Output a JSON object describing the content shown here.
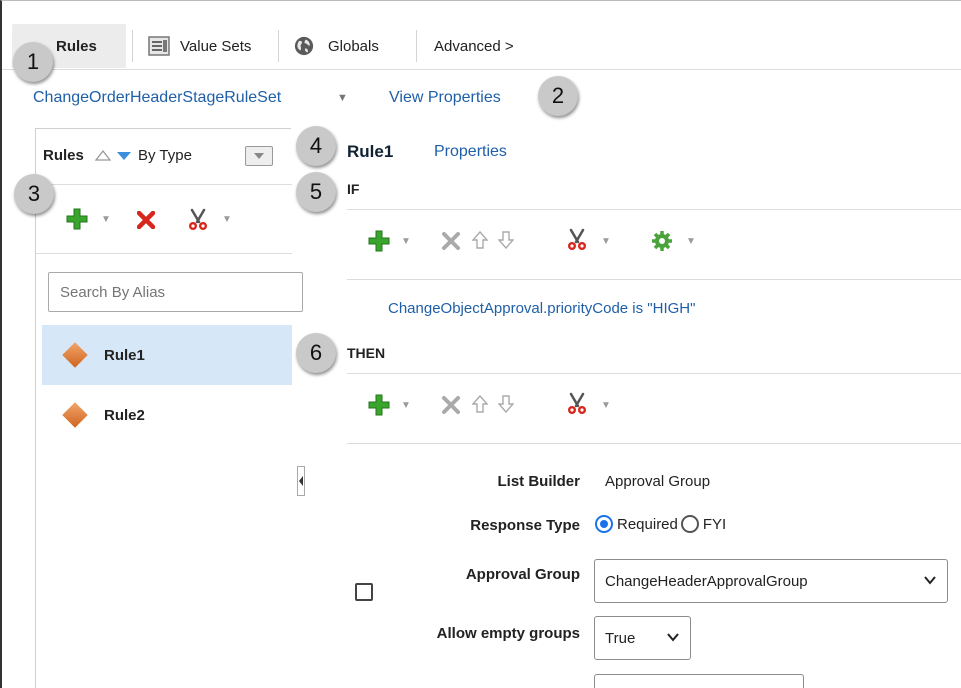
{
  "tabs": {
    "rules": "Rules",
    "value_sets": "Value Sets",
    "globals": "Globals",
    "advanced": "Advanced >"
  },
  "ruleset": {
    "name": "ChangeOrderHeaderStageRuleSet",
    "view_properties": "View Properties"
  },
  "left_panel": {
    "title": "Rules",
    "sort_label": "By Type",
    "search_placeholder": "Search By Alias",
    "rules": [
      "Rule1",
      "Rule2"
    ],
    "selected_rule": "Rule1"
  },
  "rule": {
    "title": "Rule1",
    "properties_link": "Properties",
    "if_label": "IF",
    "condition": "ChangeObjectApproval.priorityCode  is  \"HIGH\"",
    "then_label": "THEN"
  },
  "form": {
    "list_builder_label": "List Builder",
    "list_builder_value": "Approval Group",
    "response_type_label": "Response Type",
    "response_required": "Required",
    "response_fyi": "FYI",
    "response_selected": "Required",
    "approval_group_label": "Approval Group",
    "approval_group_value": "ChangeHeaderApprovalGroup",
    "allow_empty_label": "Allow empty groups",
    "allow_empty_value": "True"
  },
  "callouts": [
    "1",
    "2",
    "3",
    "4",
    "5",
    "6"
  ],
  "colors": {
    "link": "#1f5fa8",
    "selected_row": "#d6e7f7",
    "add_green": "#3aa52c",
    "delete_red": "#d9261c",
    "callout_gray": "#c9c9c9"
  },
  "icons": {
    "value_sets": "value-sets-icon",
    "globals": "globe-icon",
    "rule": "diamond-rule-icon",
    "add": "plus-icon",
    "delete": "delete-icon",
    "cut": "scissors-icon",
    "move_up": "arrow-up-icon",
    "move_down": "arrow-down-icon",
    "advanced": "gear-icon"
  }
}
